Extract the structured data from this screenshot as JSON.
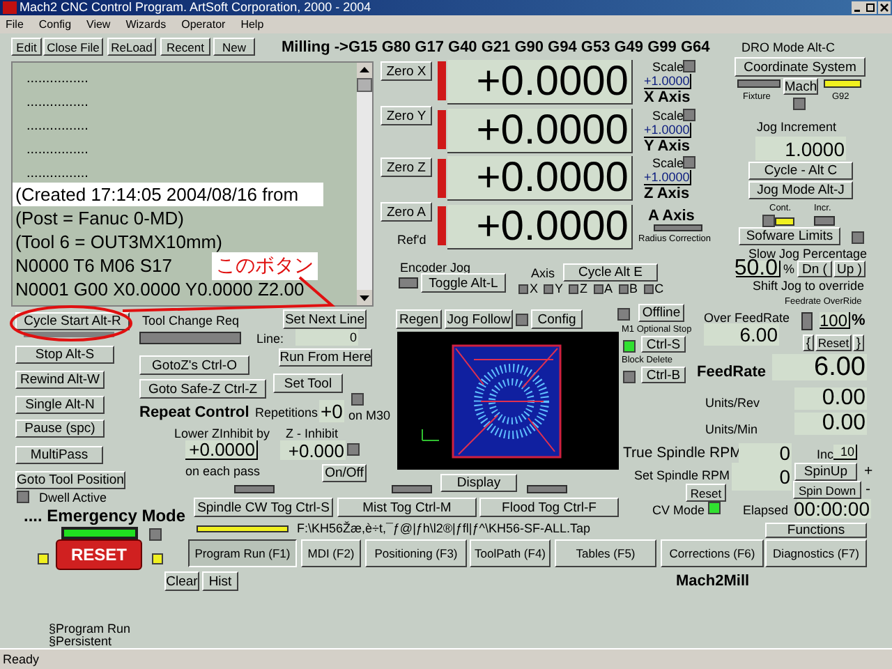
{
  "window": {
    "title": "Mach2 CNC Control Program. ArtSoft Corporation, 2000 - 2004"
  },
  "menu": [
    "File",
    "Config",
    "View",
    "Wizards",
    "Operator",
    "Help"
  ],
  "toolbar": [
    "Edit",
    "Close File",
    "ReLoad",
    "Recent",
    "New"
  ],
  "modal_line": "Milling ->G15  G80 G17 G40 G21 G90 G94 G53 G49 G99 G64",
  "listing": [
    {
      "text": "................",
      "selected": false
    },
    {
      "text": "................",
      "selected": false
    },
    {
      "text": "................",
      "selected": false
    },
    {
      "text": "................",
      "selected": false
    },
    {
      "text": "................",
      "selected": false
    },
    {
      "text": "(Created 17:14:05 2004/08/16 from",
      "selected": true
    },
    {
      "text": "(Post = Fanuc 0-MD)",
      "selected": false
    },
    {
      "text": "(Tool 6 = OUT3MX10mm)",
      "selected": false
    },
    {
      "text": "N0000 T6 M06 S17",
      "selected": false
    },
    {
      "text": "N0001 G00 X0.0000 Y0.0000 Z2.00",
      "selected": false
    }
  ],
  "callout": "このボタン",
  "run_buttons": [
    {
      "label": "Cycle Start Alt-R",
      "on": false
    },
    {
      "label": "Stop Alt-S"
    },
    {
      "label": "Rewind Alt-W"
    },
    {
      "label": "Single Alt-N"
    },
    {
      "label": "Pause (spc)"
    },
    {
      "label": "MultiPass"
    },
    {
      "label": "Goto Tool Position"
    }
  ],
  "dwell": {
    "label": "Dwell Active",
    "on": false
  },
  "emergency": {
    "label": ".... Emergency Mode",
    "on": true,
    "reset": "RESET"
  },
  "tool_change": {
    "label": "Tool Change Req",
    "on": false
  },
  "goto_buttons": [
    "GotoZ's Ctrl-O",
    "Goto Safe-Z Ctrl-Z"
  ],
  "line_control": {
    "set_next_line": "Set Next Line",
    "line_label": "Line:",
    "line_value": "0",
    "run_from_here": "Run From Here",
    "set_tool": "Set Tool"
  },
  "repeat": {
    "title": "Repeat Control",
    "repetitions_label": "Repetitions",
    "repetitions": "+0",
    "on_m30": "on M30",
    "on_m30_on": false,
    "lower_label": "Lower ZInhibit by",
    "lower_value": "+0.0000",
    "each_pass": "on each pass",
    "z_inhibit_label": "Z - Inhibit",
    "z_inhibit_value": "+0.000",
    "z_inhibit_on": false,
    "on_off": "On/Off"
  },
  "history": [
    "Clear",
    "Hist"
  ],
  "screen_labels": [
    "§Program Run",
    "§Persistent"
  ],
  "axes": [
    {
      "zero": "Zero X",
      "referenced": false,
      "value": "+0.0000",
      "scale_label": "Scale",
      "scale_on": false,
      "scale": "+1.0000",
      "name": "X Axis"
    },
    {
      "zero": "Zero Y",
      "referenced": false,
      "value": "+0.0000",
      "scale_label": "Scale",
      "scale_on": false,
      "scale": "+1.0000",
      "name": "Y Axis"
    },
    {
      "zero": "Zero Z",
      "referenced": false,
      "value": "+0.0000",
      "scale_label": "Scale",
      "scale_on": false,
      "scale": "+1.0000",
      "name": "Z Axis"
    },
    {
      "zero": "Zero A",
      "referenced": false,
      "value": "+0.0000",
      "name": "A Axis",
      "radius_correction_on": false,
      "radius_correction": "Radius Correction"
    }
  ],
  "refd": "Ref'd",
  "encoder_jog": {
    "label": "Encoder Jog",
    "button": "Toggle Alt-L",
    "on": false
  },
  "axis_select": {
    "label": "Axis",
    "button": "Cycle Alt E",
    "axes": [
      {
        "label": "X",
        "checked": false
      },
      {
        "label": "Y",
        "checked": false
      },
      {
        "label": "Z",
        "checked": false
      },
      {
        "label": "A",
        "checked": false
      },
      {
        "label": "B",
        "checked": false
      },
      {
        "label": "C",
        "checked": false
      }
    ]
  },
  "view_buttons": {
    "regen": "Regen",
    "jog_follow": "Jog Follow",
    "jog_follow_on": false,
    "config": "Config",
    "display": "Display"
  },
  "coolant": [
    {
      "label": "Spindle CW Tog Ctrl-S",
      "on": false
    },
    {
      "label": "Mist Tog Ctrl-M",
      "on": false
    },
    {
      "label": "Flood Tog Ctrl-F",
      "on": false
    }
  ],
  "file": {
    "loaded": true,
    "path": "F:\\KH56Žæ,è÷t,¯ƒ@|ƒh\\l2®|ƒfl|ƒ^\\KH56-SF-ALL.Tap"
  },
  "tabs": [
    {
      "label": "Program Run (F1)",
      "selected": true
    },
    {
      "label": "MDI (F2)",
      "selected": false
    },
    {
      "label": "Positioning (F3)",
      "selected": false
    },
    {
      "label": "ToolPath (F4)",
      "selected": false
    },
    {
      "label": "Tables (F5)",
      "selected": false
    },
    {
      "label": "Corrections (F6)",
      "selected": false
    },
    {
      "label": "Diagnostics (F7)",
      "selected": false
    }
  ],
  "functions": "Functions",
  "app_name": "Mach2Mill",
  "dro_mode": {
    "title": "DRO Mode Alt-C",
    "coordinate_system": "Coordinate System",
    "fixture_label": "Fixture",
    "fixture_on": false,
    "mach": "Mach",
    "mach_on": false,
    "g92_label": "G92",
    "g92_on": true
  },
  "jog": {
    "increment_label": "Jog Increment",
    "increment": "1.0000",
    "cycle": "Cycle - Alt C",
    "mode": "Jog Mode Alt-J",
    "cont_label": "Cont.",
    "cont_on": true,
    "incr_label": "Incr.",
    "incr_on": false,
    "limits": "Sofware Limits",
    "limits_on": false,
    "slow_label": "Slow Jog Percentage",
    "slow_value": "50.0",
    "percent": "%",
    "down": "Dn (",
    "up": "Up )",
    "shift_note": "Shift Jog to override"
  },
  "options": {
    "offline": "Offline",
    "offline_on": false,
    "m1_label": "M1 Optional Stop",
    "m1_on": true,
    "m1_button": "Ctrl-S",
    "block_delete_label": "Block Delete",
    "block_delete_on": false,
    "block_delete_button": "Ctrl-B"
  },
  "feed": {
    "over_label": "Over FeedRate",
    "over_value": "6.00",
    "override_label": "Feedrate OverRide",
    "override_on": false,
    "override_value": "100",
    "percent": "%",
    "dec": "{",
    "reset": "Reset",
    "inc": "}",
    "feedrate_label": "FeedRate",
    "feedrate": "6.00",
    "units_rev_label": "Units/Rev",
    "units_rev": "0.00",
    "units_min_label": "Units/Min",
    "units_min": "0.00"
  },
  "spindle": {
    "true_label": "True Spindle RPM",
    "true_value": "0",
    "inc_label": "Inc",
    "inc_value": "10",
    "spin_up": "SpinUp",
    "plus": "+",
    "set_label": "Set Spindle RPM",
    "set_value": "0",
    "spin_down": "Spin Down",
    "minus": "-",
    "reset": "Reset",
    "cv_label": "CV Mode",
    "cv_on": true,
    "elapsed_label": "Elapsed",
    "elapsed": "00:00:00"
  },
  "status_bar": "Ready"
}
